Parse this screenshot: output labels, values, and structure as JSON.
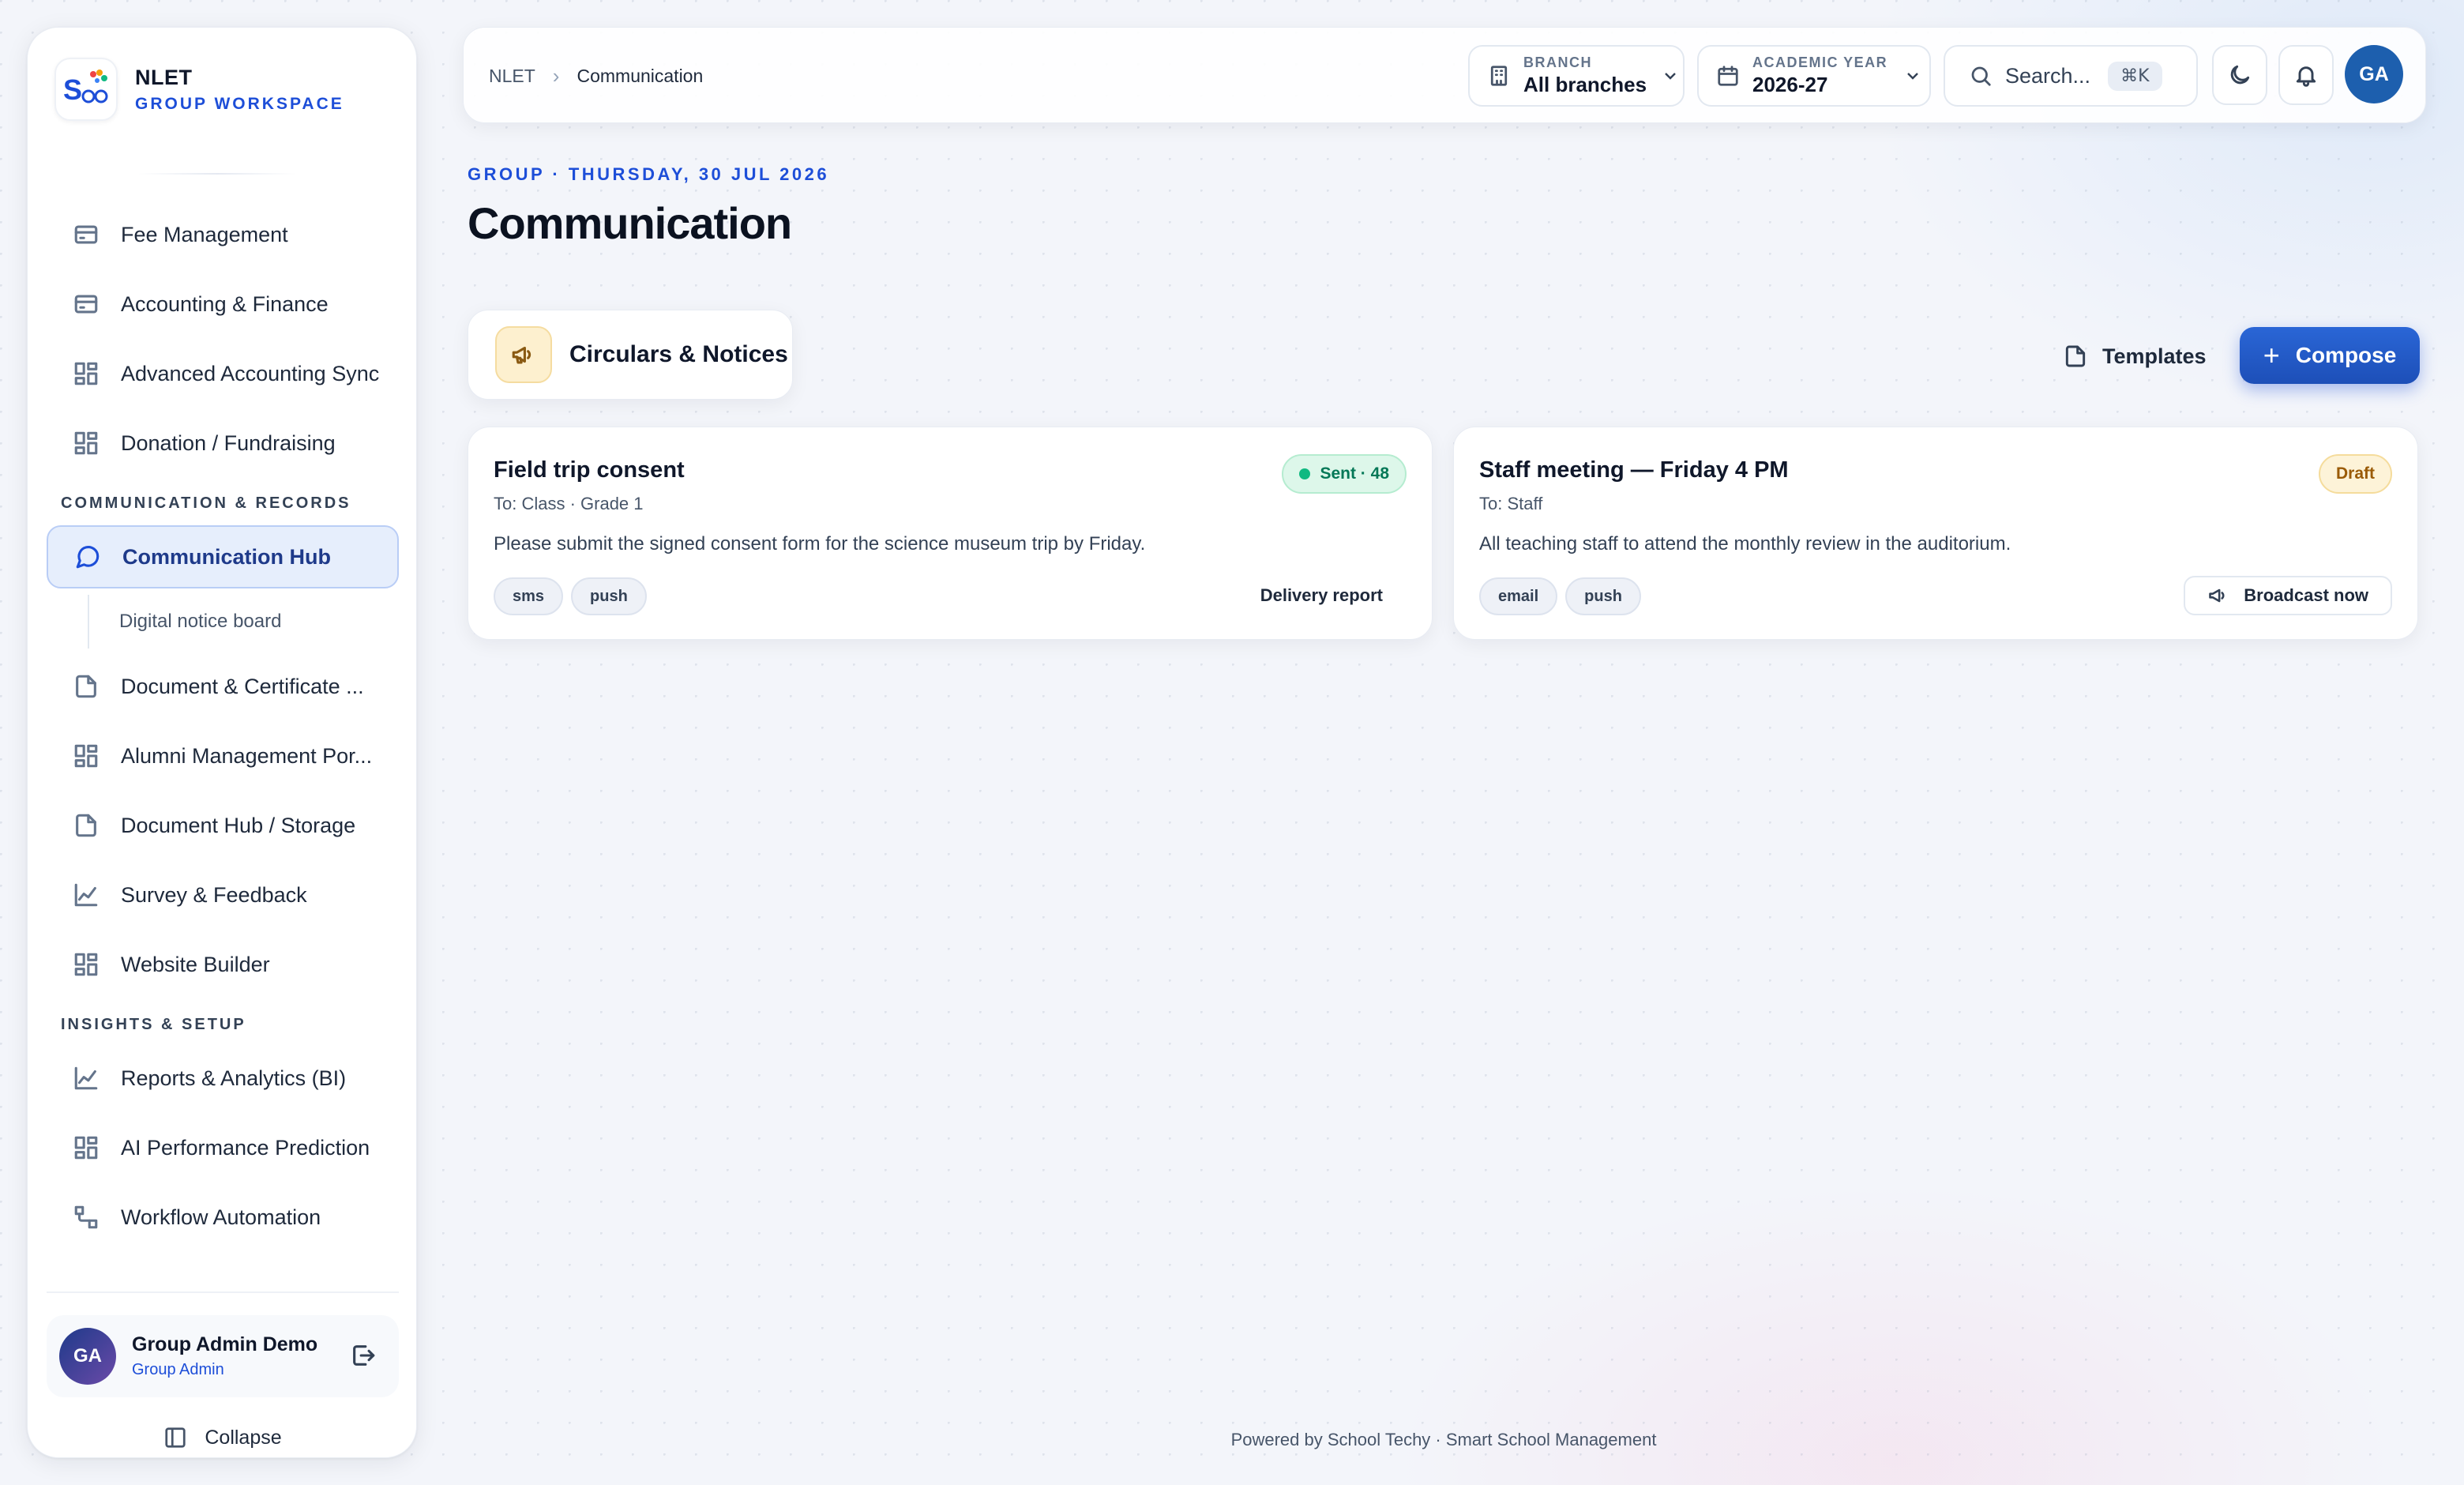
{
  "brand": {
    "name": "NLET",
    "subtitle": "GROUP WORKSPACE"
  },
  "sidebar": {
    "items_top": [
      {
        "label": "Fee Management",
        "icon": "card-icon"
      },
      {
        "label": "Accounting & Finance",
        "icon": "card-icon"
      },
      {
        "label": "Advanced Accounting Sync",
        "icon": "grid-icon"
      },
      {
        "label": "Donation / Fundraising",
        "icon": "grid-icon"
      }
    ],
    "section_comm": "COMMUNICATION & RECORDS",
    "active_item": "Communication Hub",
    "sub_item": "Digital notice board",
    "items_comm": [
      {
        "label": "Document & Certificate ...",
        "icon": "document-icon"
      },
      {
        "label": "Alumni Management Por...",
        "icon": "grid-icon"
      },
      {
        "label": "Document Hub / Storage",
        "icon": "document-icon"
      },
      {
        "label": "Survey & Feedback",
        "icon": "chart-icon"
      },
      {
        "label": "Website Builder",
        "icon": "grid-icon"
      }
    ],
    "section_insights": "INSIGHTS & SETUP",
    "items_insights": [
      {
        "label": "Reports & Analytics (BI)",
        "icon": "chart-icon"
      },
      {
        "label": "AI Performance Prediction",
        "icon": "grid-icon"
      },
      {
        "label": "Workflow Automation",
        "icon": "workflow-icon"
      }
    ],
    "user": {
      "initials": "GA",
      "name": "Group Admin Demo",
      "role": "Group Admin"
    },
    "collapse_label": "Collapse"
  },
  "topbar": {
    "breadcrumb_root": "NLET",
    "breadcrumb_current": "Communication",
    "branch_label": "BRANCH",
    "branch_value": "All branches",
    "year_label": "ACADEMIC YEAR",
    "year_value": "2026-27",
    "search_placeholder": "Search...",
    "search_shortcut": "⌘K",
    "avatar_initials": "GA"
  },
  "page": {
    "eyebrow": "GROUP · THURSDAY, 30 JUL 2026",
    "title": "Communication",
    "module_label": "Circulars & Notices",
    "templates_label": "Templates",
    "compose_label": "Compose"
  },
  "cards": [
    {
      "title": "Field trip consent",
      "to": "To: Class · Grade 1",
      "body": "Please submit the signed consent form for the science museum trip by Friday.",
      "tags": [
        "sms",
        "push"
      ],
      "status": "Sent · 48",
      "action": "Delivery report"
    },
    {
      "title": "Staff meeting — Friday 4 PM",
      "to": "To: Staff",
      "body": "All teaching staff to attend the monthly review in the auditorium.",
      "tags": [
        "email",
        "push"
      ],
      "status": "Draft",
      "action": "Broadcast now"
    }
  ],
  "footer": "Powered by School Techy · Smart School Management",
  "colors": {
    "accent": "#1d4ed8",
    "sent": "#047857",
    "draft": "#9a5b07"
  }
}
